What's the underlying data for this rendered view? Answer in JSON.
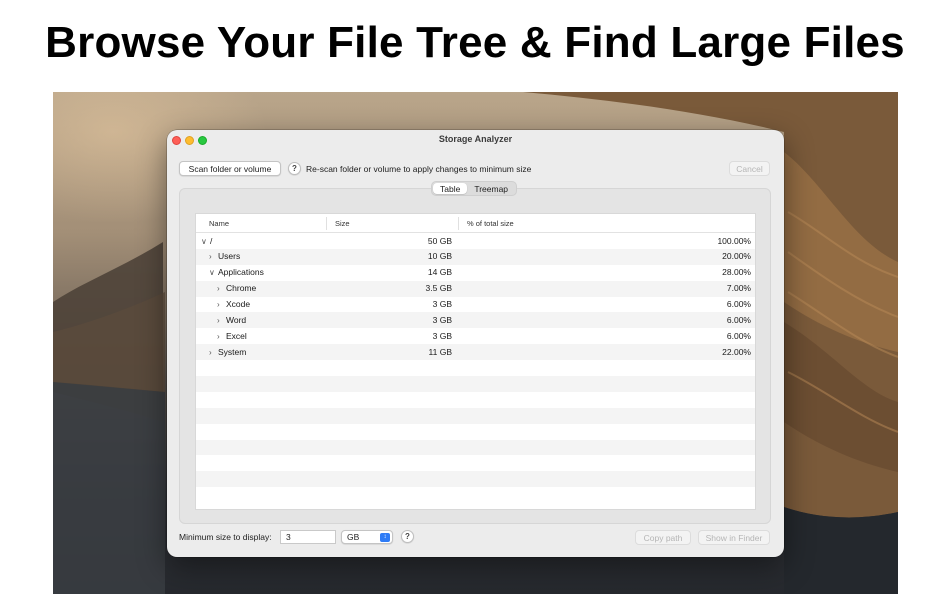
{
  "headline": "Browse Your File Tree & Find Large Files",
  "window": {
    "title": "Storage Analyzer"
  },
  "toolbar": {
    "scan_label": "Scan folder or volume",
    "help_label": "?",
    "hint": "Re-scan folder or volume to apply changes to minimum size",
    "cancel_label": "Cancel"
  },
  "tabs": [
    {
      "label": "Table",
      "active": true
    },
    {
      "label": "Treemap",
      "active": false
    }
  ],
  "table": {
    "columns": [
      "Name",
      "Size",
      "% of total size"
    ],
    "rows": [
      {
        "name": "/",
        "expanded": true,
        "level": 0,
        "size": "50 GB",
        "pct": "100.00%"
      },
      {
        "name": "Users",
        "expanded": false,
        "level": 1,
        "size": "10 GB",
        "pct": "20.00%"
      },
      {
        "name": "Applications",
        "expanded": true,
        "level": 1,
        "size": "14 GB",
        "pct": "28.00%"
      },
      {
        "name": "Chrome",
        "expanded": false,
        "level": 2,
        "size": "3.5 GB",
        "pct": "7.00%"
      },
      {
        "name": "Xcode",
        "expanded": false,
        "level": 2,
        "size": "3 GB",
        "pct": "6.00%"
      },
      {
        "name": "Word",
        "expanded": false,
        "level": 2,
        "size": "3 GB",
        "pct": "6.00%"
      },
      {
        "name": "Excel",
        "expanded": false,
        "level": 2,
        "size": "3 GB",
        "pct": "6.00%"
      },
      {
        "name": "System",
        "expanded": false,
        "level": 1,
        "size": "11 GB",
        "pct": "22.00%"
      }
    ]
  },
  "footer": {
    "min_size_label": "Minimum size to display:",
    "min_size_value": "3",
    "unit_selected": "GB",
    "help_label": "?",
    "copy_path_label": "Copy path",
    "show_in_finder_label": "Show in Finder"
  }
}
